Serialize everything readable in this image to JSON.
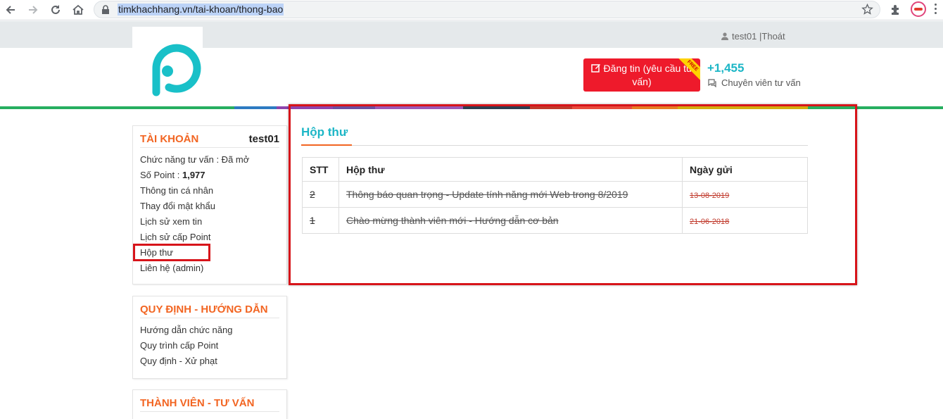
{
  "browser": {
    "url": "timkhachhang.vn/tai-khoan/thong-bao",
    "icons": [
      "back-icon",
      "forward-icon",
      "reload-icon",
      "home-icon",
      "lock-icon",
      "star-icon",
      "puzzle-icon",
      "more-icon"
    ]
  },
  "topbar": {
    "user": "test01 |Thoát"
  },
  "header": {
    "post_button": "Đăng tin (yêu cầu tư vấn)",
    "free_badge": "FREE",
    "count": "+1,455",
    "consult_label": "Chuyên viên tư vấn"
  },
  "colors": {
    "accent_teal": "#1cb6c6",
    "accent_orange": "#f26522",
    "button_red": "#ee1a2b",
    "highlight_red": "#d7141a"
  },
  "sidebar": {
    "account": {
      "title": "TÀI KHOẢN",
      "username": "test01",
      "consult_status": "Chức năng tư vấn : Đã mở",
      "points_label": "Số Point : ",
      "points_value": "1,977",
      "items": [
        "Thông tin cá nhân",
        "Thay đổi mật khẩu",
        "Lịch sử xem tin",
        "Lịch sử cấp Point",
        "Hộp thư",
        "Liên hệ (admin)"
      ]
    },
    "rules": {
      "title": "QUY ĐỊNH - HƯỚNG DẪN",
      "items": [
        "Hướng dẫn chức năng",
        "Quy trình cấp Point",
        "Quy định - Xử phạt"
      ]
    },
    "members": {
      "title": "THÀNH VIÊN - TƯ VẤN"
    }
  },
  "main": {
    "title": "Hộp thư",
    "table": {
      "headers": [
        "STT",
        "Hộp thư",
        "Ngày gửi"
      ],
      "rows": [
        {
          "stt": "2",
          "subject": "Thông báo quan trọng - Update tính năng mới Web trong 8/2019",
          "date": "13-08-2019"
        },
        {
          "stt": "1",
          "subject": "Chào mừng thành viên mới - Hướng dẫn cơ bản",
          "date": "21-06-2018"
        }
      ]
    }
  }
}
